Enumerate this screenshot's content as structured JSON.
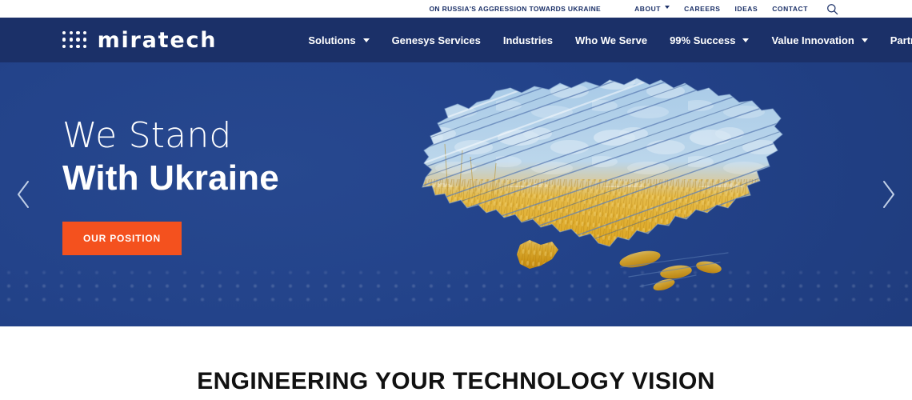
{
  "topbar": {
    "banner": "ON RUSSIA'S AGGRESSION TOWARDS UKRAINE",
    "items": [
      {
        "label": "ABOUT",
        "has_dropdown": true
      },
      {
        "label": "CAREERS",
        "has_dropdown": false
      },
      {
        "label": "IDEAS",
        "has_dropdown": false
      },
      {
        "label": "CONTACT",
        "has_dropdown": false
      }
    ],
    "search_icon": "search-icon"
  },
  "brand": {
    "name": "miratech",
    "logo_icon": "dot-matrix-logo-icon"
  },
  "nav": {
    "items": [
      {
        "label": "Solutions",
        "has_dropdown": true
      },
      {
        "label": "Genesys Services",
        "has_dropdown": false
      },
      {
        "label": "Industries",
        "has_dropdown": false
      },
      {
        "label": "Who We Serve",
        "has_dropdown": false
      },
      {
        "label": "99% Success",
        "has_dropdown": true
      },
      {
        "label": "Value Innovation",
        "has_dropdown": true
      },
      {
        "label": "Partners",
        "has_dropdown": false
      }
    ]
  },
  "hero": {
    "headline_light": "We Stand",
    "headline_bold": "With Ukraine",
    "cta_label": "OUR POSITION",
    "prev_icon": "chevron-left-icon",
    "next_icon": "chevron-right-icon",
    "artwork_name": "ukraine-map-sketch"
  },
  "section": {
    "title": "ENGINEERING YOUR TECHNOLOGY VISION"
  },
  "colors": {
    "navy": "#1B3068",
    "hero_blue": "#23438A",
    "accent_orange": "#F4511E",
    "white": "#FFFFFF",
    "heading_black": "#111111",
    "wheat_gold": "#D9A521",
    "sky_blue": "#8FB8DC"
  }
}
